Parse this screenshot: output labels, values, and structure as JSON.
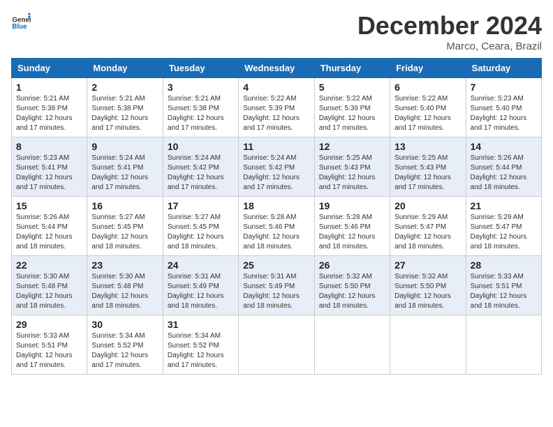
{
  "header": {
    "logo_general": "General",
    "logo_blue": "Blue",
    "month_title": "December 2024",
    "location": "Marco, Ceara, Brazil"
  },
  "weekdays": [
    "Sunday",
    "Monday",
    "Tuesday",
    "Wednesday",
    "Thursday",
    "Friday",
    "Saturday"
  ],
  "rows": [
    [
      {
        "day": "1",
        "sunrise": "5:21 AM",
        "sunset": "5:38 PM",
        "daylight": "12 hours and 17 minutes."
      },
      {
        "day": "2",
        "sunrise": "5:21 AM",
        "sunset": "5:38 PM",
        "daylight": "12 hours and 17 minutes."
      },
      {
        "day": "3",
        "sunrise": "5:21 AM",
        "sunset": "5:38 PM",
        "daylight": "12 hours and 17 minutes."
      },
      {
        "day": "4",
        "sunrise": "5:22 AM",
        "sunset": "5:39 PM",
        "daylight": "12 hours and 17 minutes."
      },
      {
        "day": "5",
        "sunrise": "5:22 AM",
        "sunset": "5:39 PM",
        "daylight": "12 hours and 17 minutes."
      },
      {
        "day": "6",
        "sunrise": "5:22 AM",
        "sunset": "5:40 PM",
        "daylight": "12 hours and 17 minutes."
      },
      {
        "day": "7",
        "sunrise": "5:23 AM",
        "sunset": "5:40 PM",
        "daylight": "12 hours and 17 minutes."
      }
    ],
    [
      {
        "day": "8",
        "sunrise": "5:23 AM",
        "sunset": "5:41 PM",
        "daylight": "12 hours and 17 minutes."
      },
      {
        "day": "9",
        "sunrise": "5:24 AM",
        "sunset": "5:41 PM",
        "daylight": "12 hours and 17 minutes."
      },
      {
        "day": "10",
        "sunrise": "5:24 AM",
        "sunset": "5:42 PM",
        "daylight": "12 hours and 17 minutes."
      },
      {
        "day": "11",
        "sunrise": "5:24 AM",
        "sunset": "5:42 PM",
        "daylight": "12 hours and 17 minutes."
      },
      {
        "day": "12",
        "sunrise": "5:25 AM",
        "sunset": "5:43 PM",
        "daylight": "12 hours and 17 minutes."
      },
      {
        "day": "13",
        "sunrise": "5:25 AM",
        "sunset": "5:43 PM",
        "daylight": "12 hours and 17 minutes."
      },
      {
        "day": "14",
        "sunrise": "5:26 AM",
        "sunset": "5:44 PM",
        "daylight": "12 hours and 18 minutes."
      }
    ],
    [
      {
        "day": "15",
        "sunrise": "5:26 AM",
        "sunset": "5:44 PM",
        "daylight": "12 hours and 18 minutes."
      },
      {
        "day": "16",
        "sunrise": "5:27 AM",
        "sunset": "5:45 PM",
        "daylight": "12 hours and 18 minutes."
      },
      {
        "day": "17",
        "sunrise": "5:27 AM",
        "sunset": "5:45 PM",
        "daylight": "12 hours and 18 minutes."
      },
      {
        "day": "18",
        "sunrise": "5:28 AM",
        "sunset": "5:46 PM",
        "daylight": "12 hours and 18 minutes."
      },
      {
        "day": "19",
        "sunrise": "5:28 AM",
        "sunset": "5:46 PM",
        "daylight": "12 hours and 18 minutes."
      },
      {
        "day": "20",
        "sunrise": "5:29 AM",
        "sunset": "5:47 PM",
        "daylight": "12 hours and 18 minutes."
      },
      {
        "day": "21",
        "sunrise": "5:29 AM",
        "sunset": "5:47 PM",
        "daylight": "12 hours and 18 minutes."
      }
    ],
    [
      {
        "day": "22",
        "sunrise": "5:30 AM",
        "sunset": "5:48 PM",
        "daylight": "12 hours and 18 minutes."
      },
      {
        "day": "23",
        "sunrise": "5:30 AM",
        "sunset": "5:48 PM",
        "daylight": "12 hours and 18 minutes."
      },
      {
        "day": "24",
        "sunrise": "5:31 AM",
        "sunset": "5:49 PM",
        "daylight": "12 hours and 18 minutes."
      },
      {
        "day": "25",
        "sunrise": "5:31 AM",
        "sunset": "5:49 PM",
        "daylight": "12 hours and 18 minutes."
      },
      {
        "day": "26",
        "sunrise": "5:32 AM",
        "sunset": "5:50 PM",
        "daylight": "12 hours and 18 minutes."
      },
      {
        "day": "27",
        "sunrise": "5:32 AM",
        "sunset": "5:50 PM",
        "daylight": "12 hours and 18 minutes."
      },
      {
        "day": "28",
        "sunrise": "5:33 AM",
        "sunset": "5:51 PM",
        "daylight": "12 hours and 18 minutes."
      }
    ],
    [
      {
        "day": "29",
        "sunrise": "5:33 AM",
        "sunset": "5:51 PM",
        "daylight": "12 hours and 17 minutes."
      },
      {
        "day": "30",
        "sunrise": "5:34 AM",
        "sunset": "5:52 PM",
        "daylight": "12 hours and 17 minutes."
      },
      {
        "day": "31",
        "sunrise": "5:34 AM",
        "sunset": "5:52 PM",
        "daylight": "12 hours and 17 minutes."
      },
      null,
      null,
      null,
      null
    ]
  ],
  "labels": {
    "sunrise_prefix": "Sunrise: ",
    "sunset_prefix": "Sunset: ",
    "daylight_prefix": "Daylight: "
  }
}
